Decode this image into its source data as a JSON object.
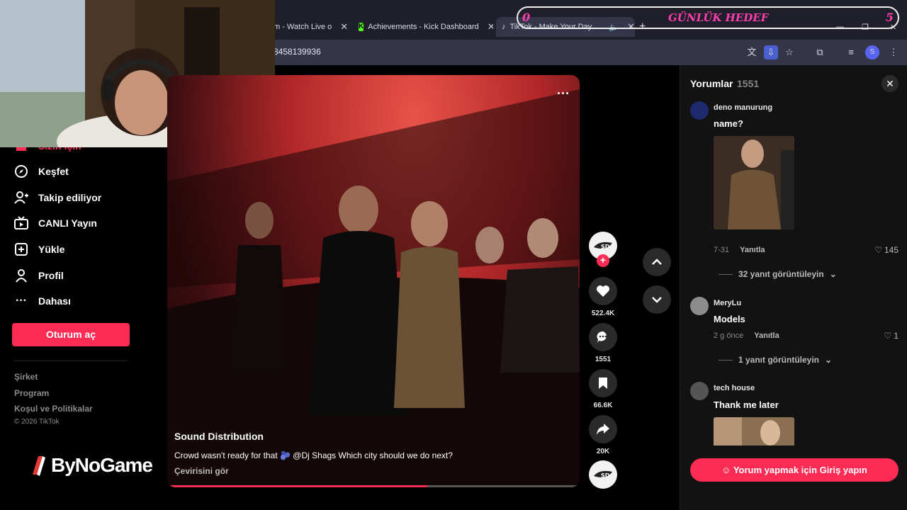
{
  "browser": {
    "tabs": [
      {
        "title": "am - Watch Live o"
      },
      {
        "title": "Achievements - Kick Dashboard"
      },
      {
        "title": "TikTok - Make Your Day"
      }
    ],
    "new_tab": "+",
    "url": "8458139936",
    "profile_initial": "S"
  },
  "goal_overlay": {
    "left": "0",
    "center": "GÜNLÜK HEDEF",
    "right": "5"
  },
  "sidebar": {
    "partial_top": "Sizin için",
    "items": [
      {
        "label": "Keşfet",
        "icon": "compass-icon"
      },
      {
        "label": "Takip ediliyor",
        "icon": "user-follow-icon"
      },
      {
        "label": "CANLI Yayın",
        "icon": "live-tv-icon"
      },
      {
        "label": "Yükle",
        "icon": "upload-icon"
      },
      {
        "label": "Profil",
        "icon": "user-icon"
      },
      {
        "label": "Dahası",
        "icon": "more-dots-icon"
      }
    ],
    "login_label": "Oturum aç",
    "footer_links": [
      "Şirket",
      "Program",
      "Koşul ve Politikalar"
    ],
    "copyright": "© 2026 TikTok"
  },
  "logo": {
    "text": "ByNoGame"
  },
  "video": {
    "author": "Sound Distribution",
    "caption": "Crowd wasn't ready for that 🫐 @Dj Shags Which city should we do next?",
    "translate": "Çevirisini gör",
    "progress": 0.63
  },
  "actions": {
    "likes": "522.4K",
    "comments": "1551",
    "saves": "66.6K",
    "shares": "20K"
  },
  "comments_panel": {
    "title": "Yorumlar",
    "count": "1551",
    "login_prompt": "Yorum yapmak için Giriş yapın",
    "reply_label": "Yanıtla",
    "items": [
      {
        "user": "deno manurung",
        "text": "name?",
        "date": "7-31",
        "likes": "145",
        "replies": "32 yanıt görüntüleyin"
      },
      {
        "user": "MeryLu",
        "text": "Models",
        "date": "2 g önce",
        "likes": "1",
        "replies": "1 yanıt görüntüleyin"
      },
      {
        "user": "tech house",
        "text": "Thank me later"
      }
    ]
  },
  "colors": {
    "accent": "#fe2c55",
    "panel": "#121212",
    "overlay_text": "#ff3fae"
  }
}
